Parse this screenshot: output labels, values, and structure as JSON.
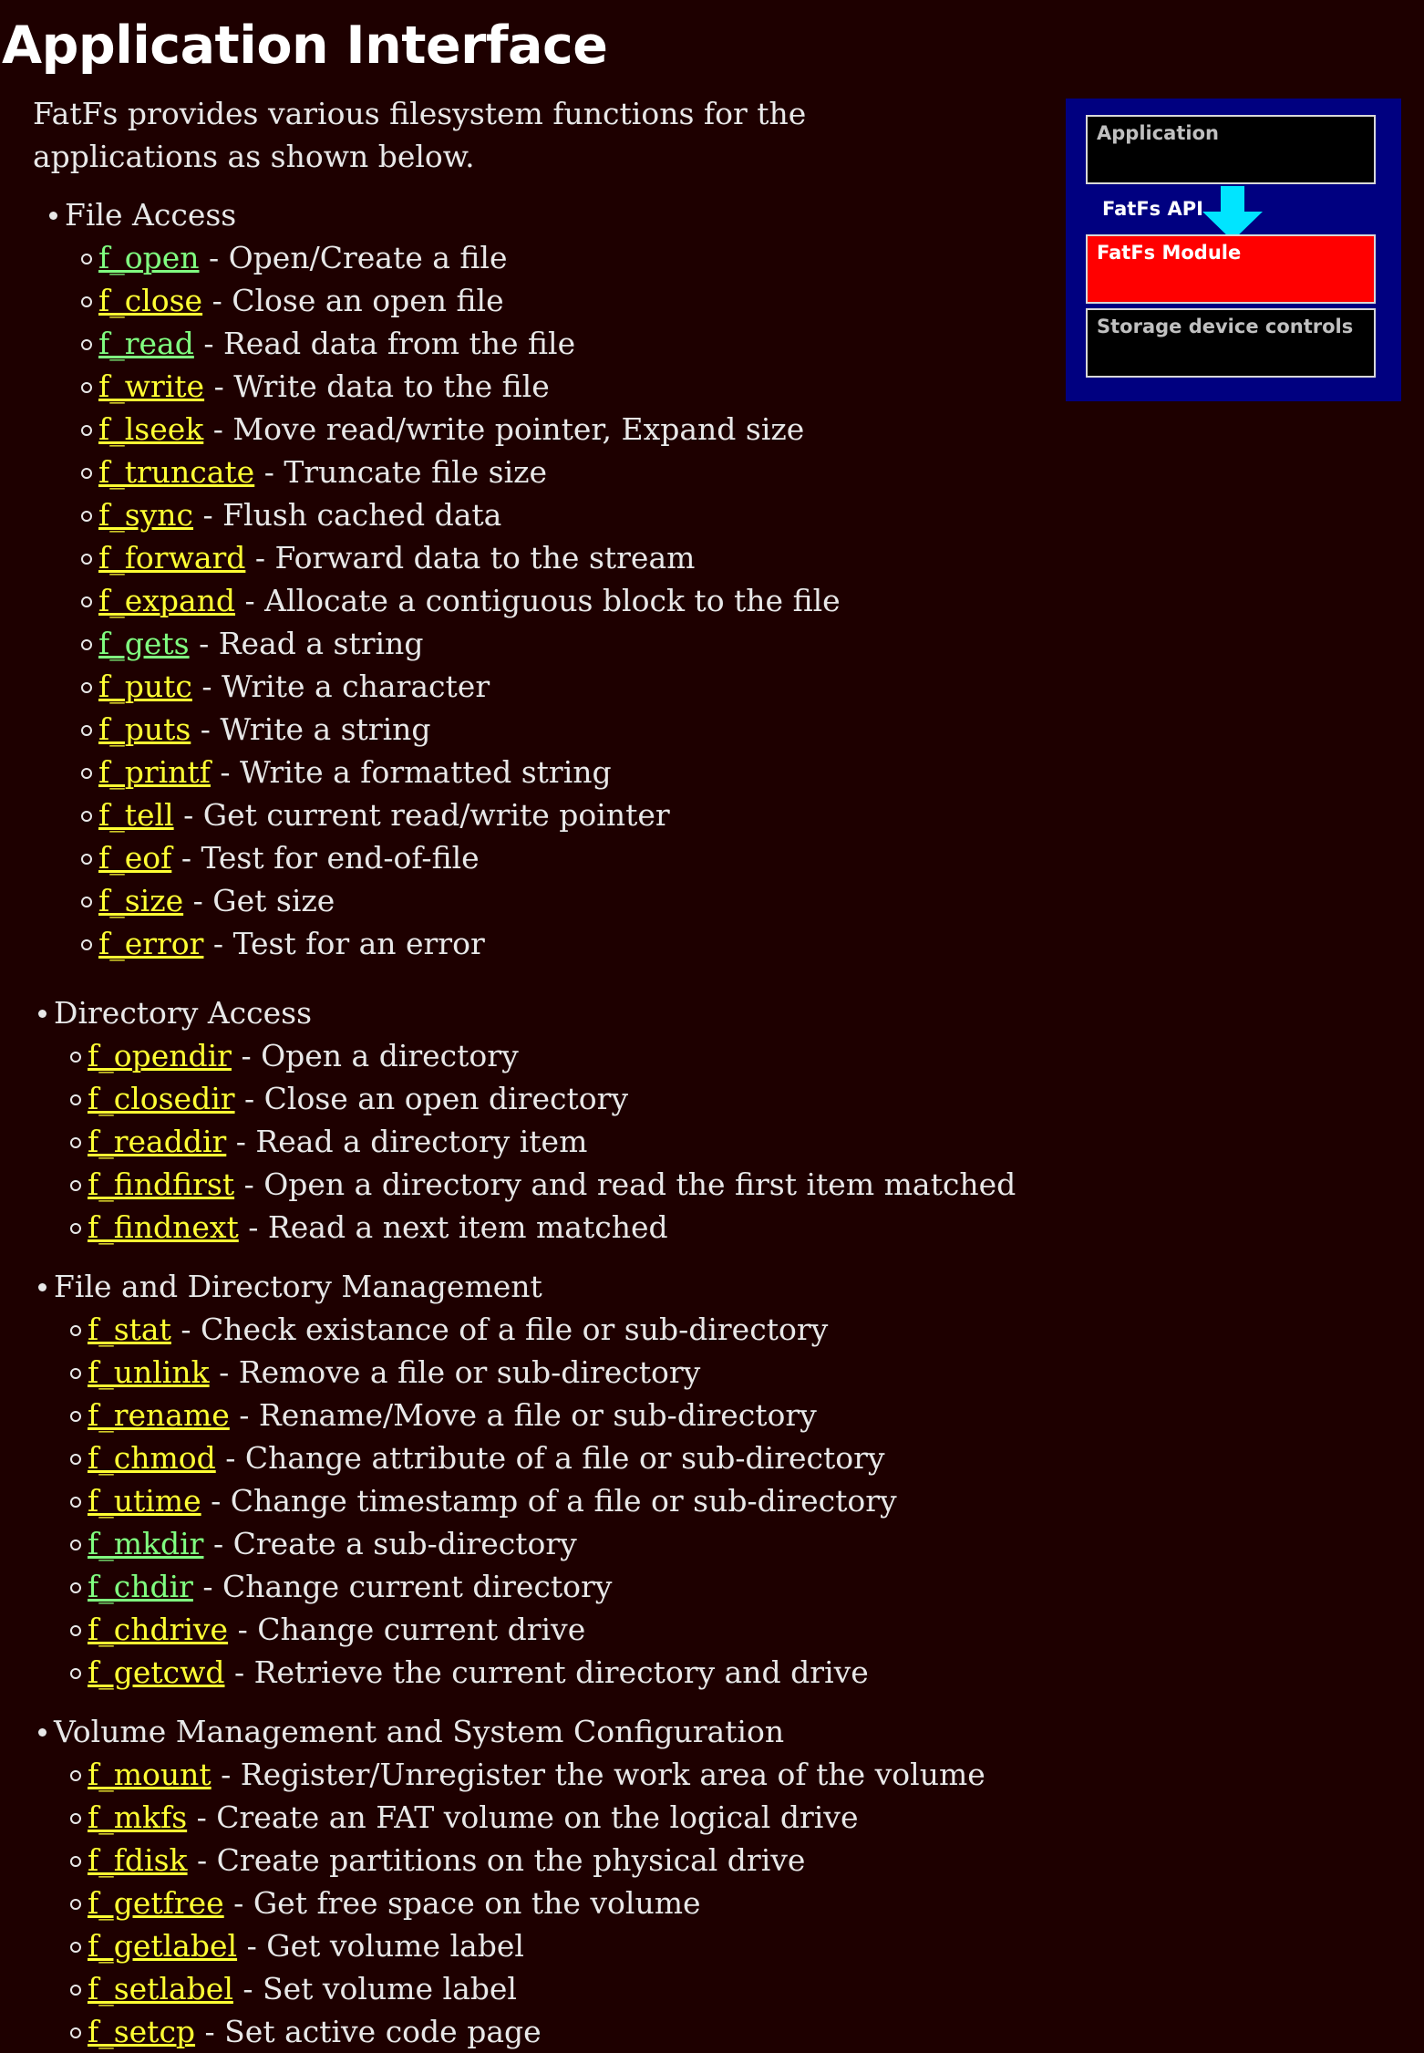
{
  "title": "Application Interface",
  "intro": "FatFs provides various filesystem functions for the applications as shown below.",
  "diagram": {
    "application": "Application",
    "api": "FatFs API",
    "module": "FatFs Module",
    "storage": "Storage device controls",
    "colors": {
      "background": "#000080",
      "module": "#ff0000",
      "arrow": "#00e5ff"
    }
  },
  "sections": [
    {
      "heading": "File Access",
      "items": [
        {
          "fn": "f_open",
          "desc": " - Open/Create a file",
          "visited": true
        },
        {
          "fn": "f_close",
          "desc": " - Close an open file",
          "visited": false
        },
        {
          "fn": "f_read",
          "desc": " - Read data from the file",
          "visited": true
        },
        {
          "fn": "f_write",
          "desc": " - Write data to the file",
          "visited": false
        },
        {
          "fn": "f_lseek",
          "desc": " - Move read/write pointer, Expand size",
          "visited": false
        },
        {
          "fn": "f_truncate",
          "desc": " - Truncate file size",
          "visited": false
        },
        {
          "fn": "f_sync",
          "desc": " - Flush cached data",
          "visited": false
        },
        {
          "fn": "f_forward",
          "desc": " - Forward data to the stream",
          "visited": false
        },
        {
          "fn": "f_expand",
          "desc": " - Allocate a contiguous block to the file",
          "visited": false
        },
        {
          "fn": "f_gets",
          "desc": " - Read a string",
          "visited": true
        },
        {
          "fn": "f_putc",
          "desc": " - Write a character",
          "visited": false
        },
        {
          "fn": "f_puts",
          "desc": " - Write a string",
          "visited": false
        },
        {
          "fn": "f_printf",
          "desc": " - Write a formatted string",
          "visited": false
        },
        {
          "fn": "f_tell",
          "desc": " - Get current read/write pointer",
          "visited": false
        },
        {
          "fn": "f_eof",
          "desc": " - Test for end-of-file",
          "visited": false
        },
        {
          "fn": "f_size",
          "desc": " - Get size",
          "visited": false
        },
        {
          "fn": "f_error",
          "desc": " - Test for an error",
          "visited": false
        }
      ]
    },
    {
      "heading": "Directory Access",
      "items": [
        {
          "fn": "f_opendir",
          "desc": " - Open a directory",
          "visited": false
        },
        {
          "fn": "f_closedir",
          "desc": " - Close an open directory",
          "visited": false
        },
        {
          "fn": "f_readdir",
          "desc": " - Read a directory item",
          "visited": false
        },
        {
          "fn": "f_findfirst",
          "desc": " - Open a directory and read the first item matched",
          "visited": false
        },
        {
          "fn": "f_findnext",
          "desc": " - Read a next item matched",
          "visited": false
        }
      ]
    },
    {
      "heading": "File and Directory Management",
      "items": [
        {
          "fn": "f_stat",
          "desc": " - Check existance of a file or sub-directory",
          "visited": false
        },
        {
          "fn": "f_unlink",
          "desc": " - Remove a file or sub-directory",
          "visited": false
        },
        {
          "fn": "f_rename",
          "desc": " - Rename/Move a file or sub-directory",
          "visited": false
        },
        {
          "fn": "f_chmod",
          "desc": " - Change attribute of a file or sub-directory",
          "visited": false
        },
        {
          "fn": "f_utime",
          "desc": " - Change timestamp of a file or sub-directory",
          "visited": false
        },
        {
          "fn": "f_mkdir",
          "desc": " - Create a sub-directory",
          "visited": true
        },
        {
          "fn": "f_chdir",
          "desc": " - Change current directory",
          "visited": true
        },
        {
          "fn": "f_chdrive",
          "desc": " - Change current drive",
          "visited": false
        },
        {
          "fn": "f_getcwd",
          "desc": " - Retrieve the current directory and drive",
          "visited": false
        }
      ]
    },
    {
      "heading": "Volume Management and System Configuration",
      "items": [
        {
          "fn": "f_mount",
          "desc": " - Register/Unregister the work area of the volume",
          "visited": false
        },
        {
          "fn": "f_mkfs",
          "desc": " - Create an FAT volume on the logical drive",
          "visited": false
        },
        {
          "fn": "f_fdisk",
          "desc": " - Create partitions on the physical drive",
          "visited": false
        },
        {
          "fn": "f_getfree",
          "desc": " - Get free space on the volume",
          "visited": false
        },
        {
          "fn": "f_getlabel",
          "desc": " - Get volume label",
          "visited": false
        },
        {
          "fn": "f_setlabel",
          "desc": " - Set volume label",
          "visited": false
        },
        {
          "fn": "f_setcp",
          "desc": " - Set active code page",
          "visited": false
        }
      ]
    }
  ]
}
